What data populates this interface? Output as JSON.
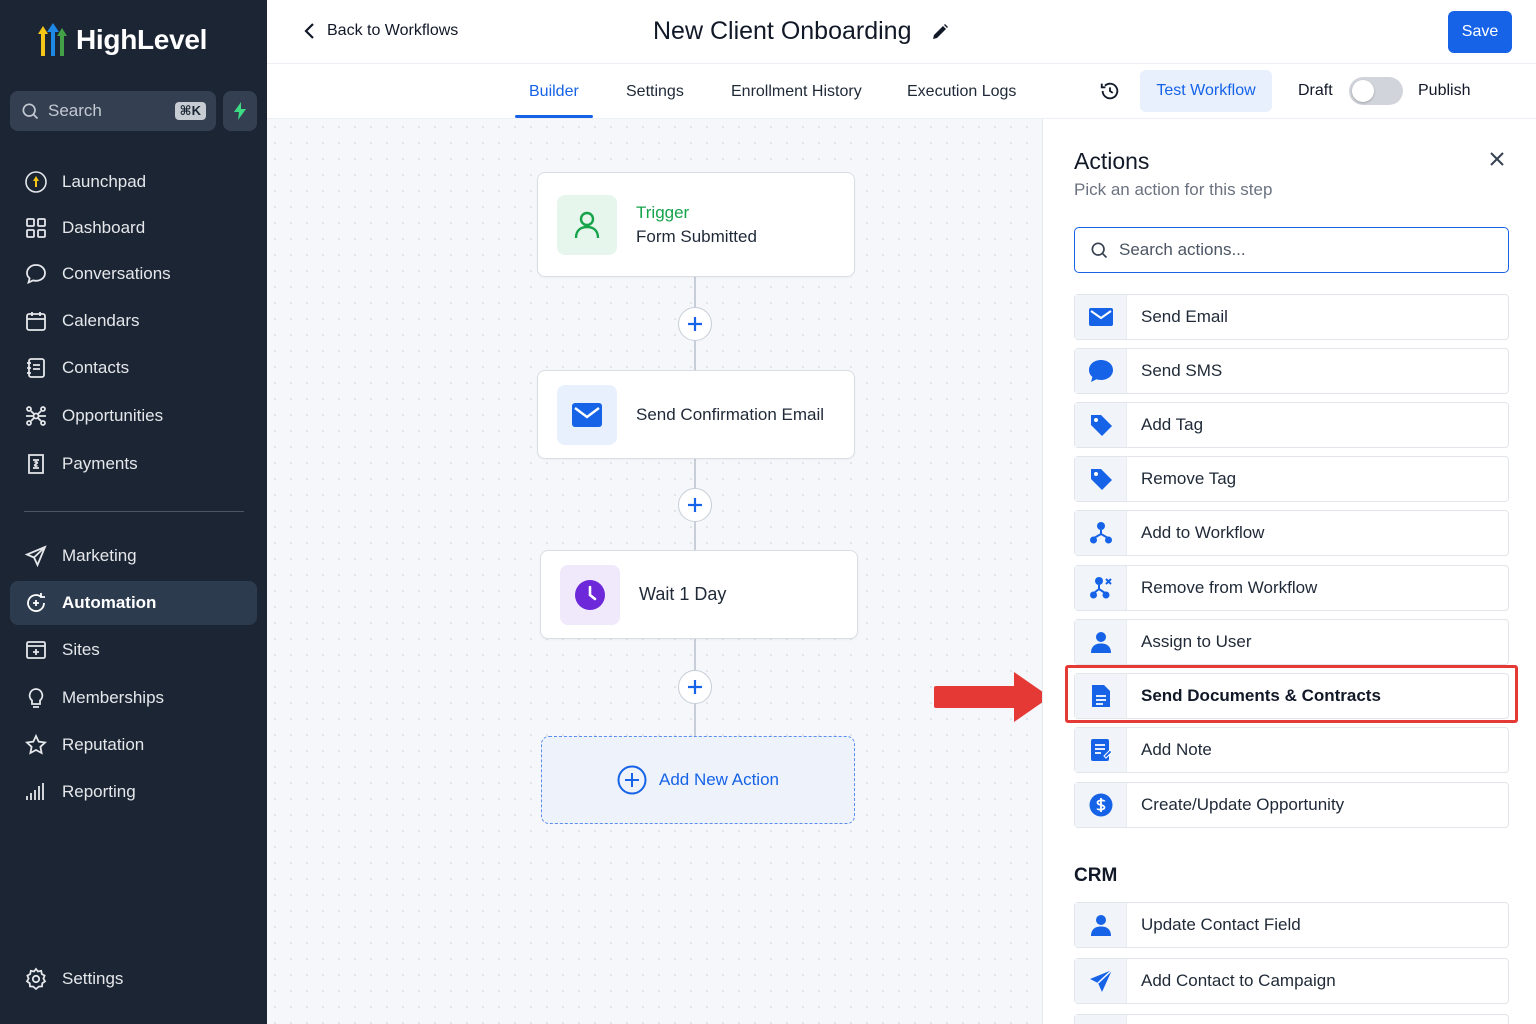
{
  "brand": {
    "name": "HighLevel"
  },
  "sidebar": {
    "search_placeholder": "Search",
    "search_shortcut": "⌘K",
    "items": [
      {
        "label": "Launchpad",
        "icon": "launchpad-icon"
      },
      {
        "label": "Dashboard",
        "icon": "dashboard-icon"
      },
      {
        "label": "Conversations",
        "icon": "conversations-icon"
      },
      {
        "label": "Calendars",
        "icon": "calendar-icon"
      },
      {
        "label": "Contacts",
        "icon": "contacts-icon"
      },
      {
        "label": "Opportunities",
        "icon": "opportunities-icon"
      },
      {
        "label": "Payments",
        "icon": "payments-icon"
      },
      {
        "label": "Marketing",
        "icon": "send-icon"
      },
      {
        "label": "Automation",
        "icon": "automation-icon",
        "active": true
      },
      {
        "label": "Sites",
        "icon": "sites-icon"
      },
      {
        "label": "Memberships",
        "icon": "memberships-icon"
      },
      {
        "label": "Reputation",
        "icon": "star-icon"
      },
      {
        "label": "Reporting",
        "icon": "reporting-icon"
      }
    ],
    "settings_label": "Settings"
  },
  "header": {
    "back_label": "Back to Workflows",
    "title": "New Client Onboarding",
    "save_label": "Save"
  },
  "tabs": {
    "items": [
      "Builder",
      "Settings",
      "Enrollment History",
      "Execution Logs"
    ],
    "active": "Builder",
    "test_label": "Test Workflow",
    "draft_label": "Draft",
    "publish_label": "Publish",
    "published": false
  },
  "workflow": {
    "trigger_title": "Trigger",
    "trigger_sub": "Form Submitted",
    "step1": "Send Confirmation Email",
    "step2": "Wait 1 Day",
    "add_action": "Add New Action"
  },
  "panel": {
    "title": "Actions",
    "subtitle": "Pick an action for this step",
    "search_placeholder": "Search actions...",
    "actions": [
      "Send Email",
      "Send SMS",
      "Add Tag",
      "Remove Tag",
      "Add to Workflow",
      "Remove from Workflow",
      "Assign to User",
      "Send Documents & Contracts",
      "Add Note",
      "Create/Update Opportunity"
    ],
    "highlighted": "Send Documents & Contracts",
    "crm_title": "CRM",
    "crm_actions": [
      "Update Contact Field",
      "Add Contact to Campaign"
    ]
  },
  "colors": {
    "accent": "#1663e8",
    "sidebar": "#1b2533",
    "highlight": "#e53935",
    "trigger": "#16a34a",
    "wait": "#6d28d9"
  }
}
